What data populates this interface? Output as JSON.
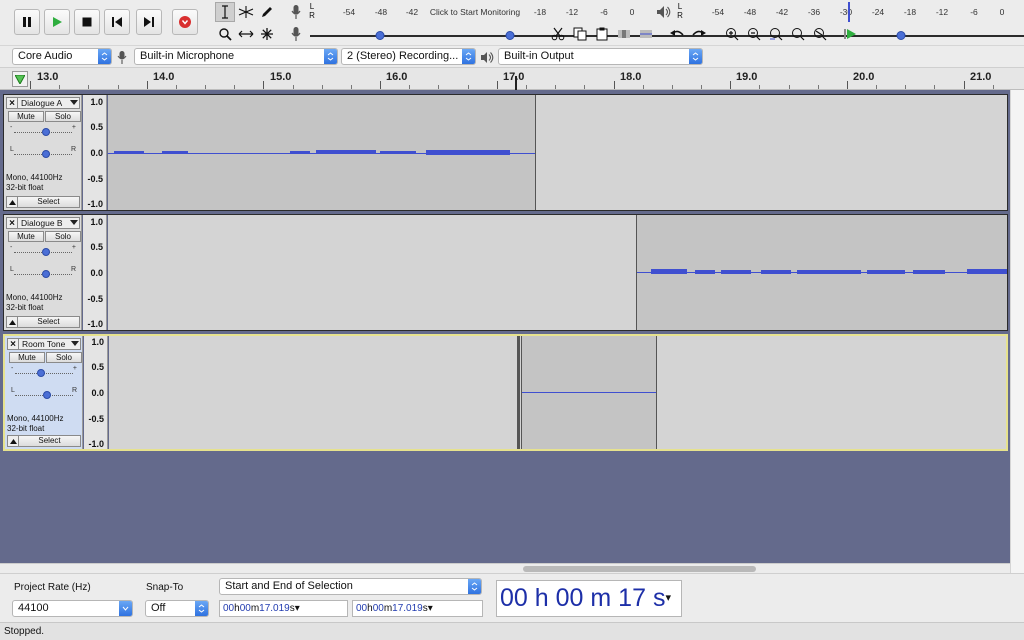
{
  "toolbar": {
    "meter_labels": [
      "-54",
      "-48",
      "-42",
      "-18",
      "-12",
      "-6",
      "0"
    ],
    "click_to_monitor": "Click to Start Monitoring",
    "playback_meter_labels": [
      "-54",
      "-48",
      "-42",
      "-36",
      "-30",
      "-24",
      "-18",
      "-12",
      "-6",
      "0"
    ],
    "channel_L": "L",
    "channel_R": "R",
    "accent_play": "#2fae3f",
    "accent_record": "#d93030"
  },
  "device": {
    "host": "Core Audio",
    "input": "Built-in Microphone",
    "channels": "2 (Stereo) Recording...",
    "output": "Built-in Output"
  },
  "ruler": {
    "labels": [
      "13.0",
      "14.0",
      "15.0",
      "16.0",
      "17.0",
      "18.0",
      "19.0",
      "20.0",
      "21.0"
    ]
  },
  "tracks": [
    {
      "name": "Dialogue A",
      "mute": "Mute",
      "solo": "Solo",
      "format": "Mono, 44100Hz",
      "bits": "32-bit float",
      "select": "Select",
      "gain_min": "-",
      "gain_max": "+",
      "pan_l": "L",
      "pan_r": "R",
      "scale": [
        "1.0",
        "0.5",
        "0.0",
        "-0.5",
        "-1.0"
      ]
    },
    {
      "name": "Dialogue B",
      "mute": "Mute",
      "solo": "Solo",
      "format": "Mono, 44100Hz",
      "bits": "32-bit float",
      "select": "Select",
      "gain_min": "-",
      "gain_max": "+",
      "pan_l": "L",
      "pan_r": "R",
      "scale": [
        "1.0",
        "0.5",
        "0.0",
        "-0.5",
        "-1.0"
      ]
    },
    {
      "name": "Room Tone",
      "mute": "Mute",
      "solo": "Solo",
      "format": "Mono, 44100Hz",
      "bits": "32-bit float",
      "select": "Select",
      "gain_min": "-",
      "gain_max": "+",
      "pan_l": "L",
      "pan_r": "R",
      "scale": [
        "1.0",
        "0.5",
        "0.0",
        "-0.5",
        "-1.0"
      ]
    }
  ],
  "selection": {
    "project_rate_label": "Project Rate (Hz)",
    "project_rate": "44100",
    "snap_to_label": "Snap-To",
    "snap_to": "Off",
    "mode": "Start and End of Selection",
    "start": {
      "h": "00",
      "m": "00",
      "s": "17.019",
      "hu": "h",
      "mu": "m",
      "su": "s"
    },
    "end": {
      "h": "00",
      "m": "00",
      "s": "17.019",
      "hu": "h",
      "mu": "m",
      "su": "s"
    },
    "audio_position": {
      "h": "00",
      "m": "00",
      "s": "17",
      "hu": "h",
      "mu": "m",
      "su": "s"
    }
  },
  "status": "Stopped."
}
